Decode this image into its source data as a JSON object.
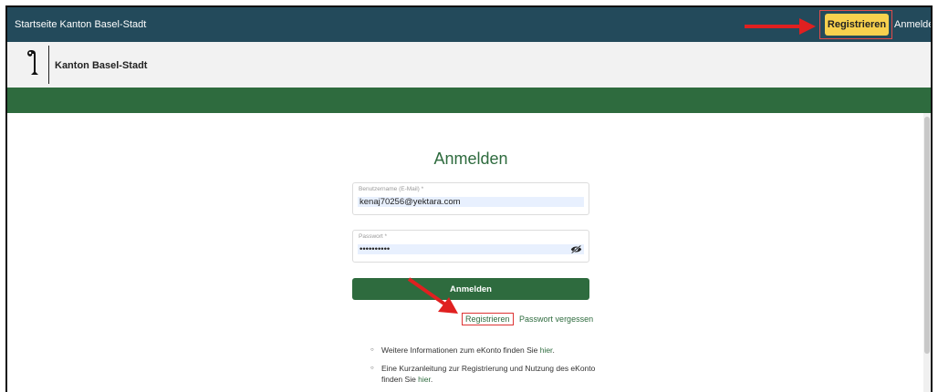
{
  "header": {
    "home_link": "Startseite Kanton Basel-Stadt",
    "register_button": "Registrieren",
    "login_link": "Anmelden"
  },
  "brand": {
    "name": "Kanton Basel-Stadt",
    "logo_icon": "basel-staff-icon"
  },
  "login_form": {
    "title": "Anmelden",
    "username_label": "Benutzername (E-Mail) *",
    "username_value": "kenaj70256@yektara.com",
    "password_label": "Passwort *",
    "password_value": "••••••••••",
    "password_toggle_icon": "eye-slash-icon",
    "submit_label": "Anmelden",
    "register_link": "Registrieren",
    "forgot_link": "Passwort vergessen"
  },
  "info": {
    "item1_text": "Weitere Informationen zum eKonto finden Sie ",
    "item1_link": "hier",
    "item1_end": ".",
    "item2_text": "Eine Kurzanleitung zur Registrierung und Nutzung des eKonto finden Sie ",
    "item2_link": "hier",
    "item2_end": "."
  },
  "colors": {
    "topbar": "#234a5b",
    "accent_green": "#2e6b3e",
    "register_yellow": "#f7d14e",
    "annotation_red": "#e02020"
  }
}
